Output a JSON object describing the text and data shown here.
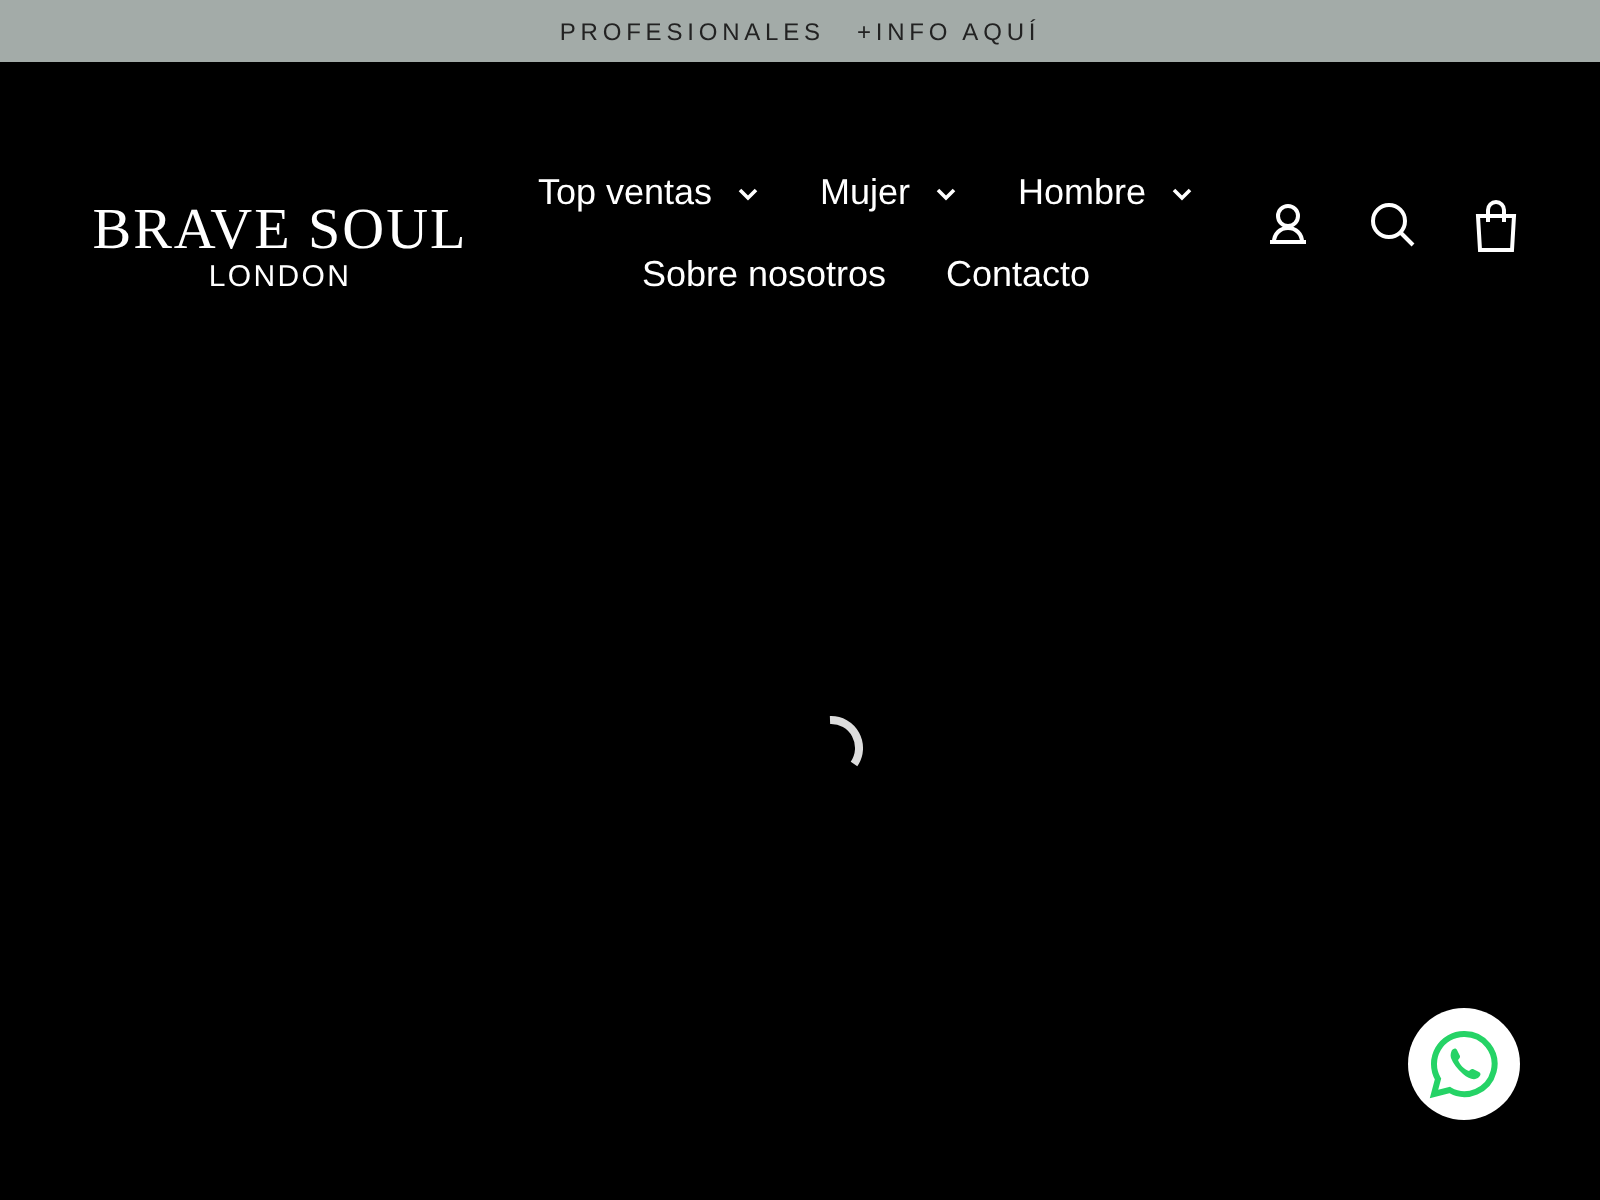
{
  "announcement": {
    "items": [
      "PROFESIONALES",
      "+INFO AQUÍ"
    ]
  },
  "logo": {
    "title": "BRAVE SOUL",
    "subtitle": "LONDON"
  },
  "nav": [
    {
      "label": "Top ventas",
      "dropdown": true
    },
    {
      "label": "Mujer",
      "dropdown": true
    },
    {
      "label": "Hombre",
      "dropdown": true
    },
    {
      "label": "Sobre nosotros",
      "dropdown": false
    },
    {
      "label": "Contacto",
      "dropdown": false
    }
  ]
}
